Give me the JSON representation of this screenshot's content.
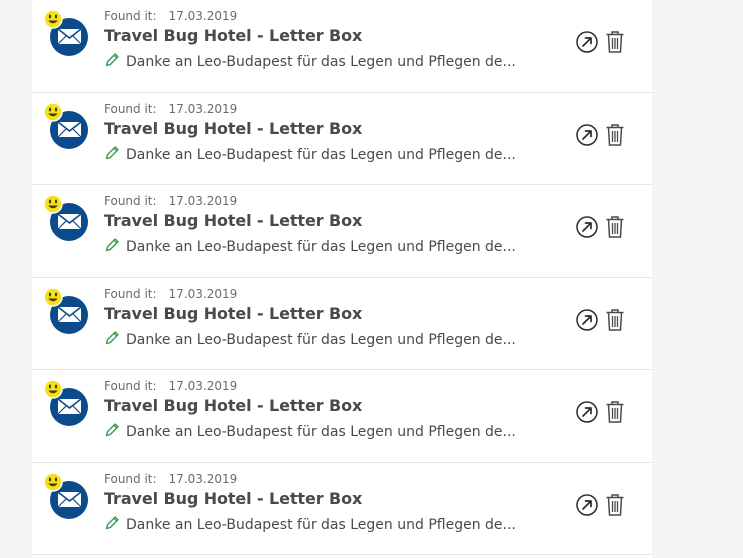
{
  "log_entries": [
    {
      "found_label": "Found it:",
      "date": "17.03.2019",
      "cache_name": "Travel Bug Hotel - Letter Box",
      "log_text": "Danke an Leo-Budapest für das Legen und Pflegen de...",
      "cache_type_icon": "letterbox-envelope-icon",
      "status_icon": "smiley-found-icon"
    },
    {
      "found_label": "Found it:",
      "date": "17.03.2019",
      "cache_name": "Travel Bug Hotel - Letter Box",
      "log_text": "Danke an Leo-Budapest für das Legen und Pflegen de...",
      "cache_type_icon": "letterbox-envelope-icon",
      "status_icon": "smiley-found-icon"
    },
    {
      "found_label": "Found it:",
      "date": "17.03.2019",
      "cache_name": "Travel Bug Hotel - Letter Box",
      "log_text": "Danke an Leo-Budapest für das Legen und Pflegen de...",
      "cache_type_icon": "letterbox-envelope-icon",
      "status_icon": "smiley-found-icon"
    },
    {
      "found_label": "Found it:",
      "date": "17.03.2019",
      "cache_name": "Travel Bug Hotel - Letter Box",
      "log_text": "Danke an Leo-Budapest für das Legen und Pflegen de...",
      "cache_type_icon": "letterbox-envelope-icon",
      "status_icon": "smiley-found-icon"
    },
    {
      "found_label": "Found it:",
      "date": "17.03.2019",
      "cache_name": "Travel Bug Hotel - Letter Box",
      "log_text": "Danke an Leo-Budapest für das Legen und Pflegen de...",
      "cache_type_icon": "letterbox-envelope-icon",
      "status_icon": "smiley-found-icon"
    },
    {
      "found_label": "Found it:",
      "date": "17.03.2019",
      "cache_name": "Travel Bug Hotel - Letter Box",
      "log_text": "Danke an Leo-Budapest für das Legen und Pflegen de...",
      "cache_type_icon": "letterbox-envelope-icon",
      "status_icon": "smiley-found-icon"
    }
  ],
  "icons": {
    "log_edit": "pencil-icon",
    "open": "open-external-arrow-icon",
    "delete": "trash-icon"
  },
  "colors": {
    "cache_icon_blue": "#0b4b8c",
    "smiley_yellow": "#f4e11a",
    "pencil_green": "#3c9b52",
    "text_dark": "#4a4a4a",
    "text_muted": "#6b6b6b",
    "divider": "#e6e6e6",
    "page_background": "#f4f4f4"
  }
}
